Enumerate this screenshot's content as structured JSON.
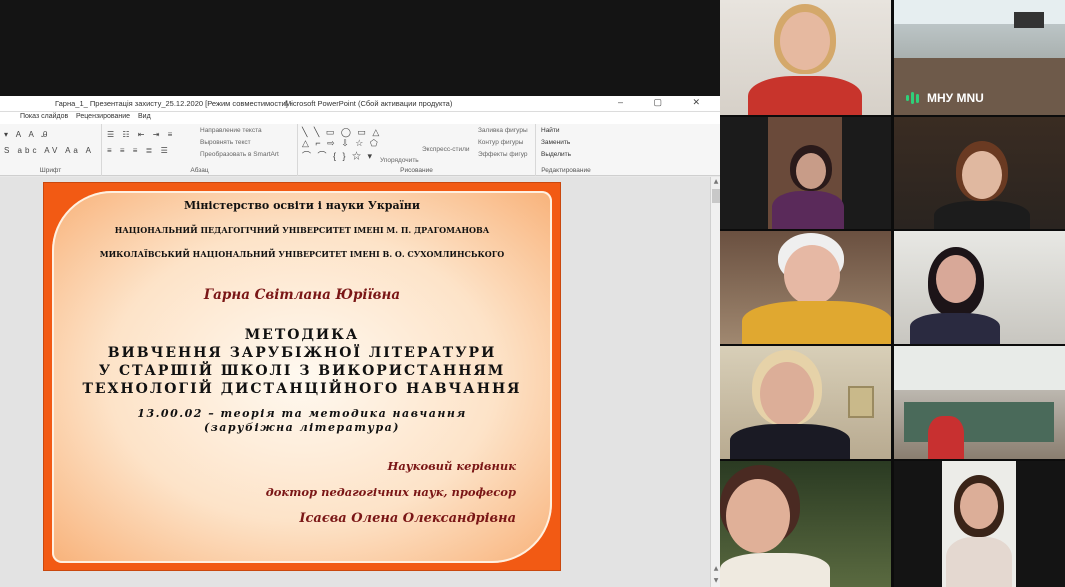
{
  "window": {
    "title": "Гарна_1_ Презентація захисту_25.12.2020 [Режим совместимости]  -",
    "app": "Microsoft PowerPoint (Сбой активации продукта)",
    "controls": "– ▢ ✕"
  },
  "tabs": [
    "Показ слайдов",
    "Рецензирование",
    "Вид"
  ],
  "ribbon": {
    "groups": [
      {
        "label": "Шрифт"
      },
      {
        "label": "Абзац"
      },
      {
        "label": "Рисование"
      },
      {
        "label": "Редактирование"
      }
    ],
    "paragraph_items": [
      "Направление текста",
      "Выровнять текст",
      "Преобразовать в SmartArt"
    ],
    "drawing_items": [
      "Упорядочить",
      "Экспресс-стили",
      "Заливка фигуры",
      "Контур фигуры",
      "Эффекты фигур"
    ],
    "editing_items": [
      "Найти",
      "Заменить",
      "Выделить"
    ]
  },
  "slide": {
    "ministry": "Міністерство освіти і науки України",
    "univ1": "НАЦІОНАЛЬНИЙ ПЕДАГОГІЧНИЙ УНІВЕРСИТЕТ ІМЕНІ М. П. ДРАГОМАНОВА",
    "univ2": "МИКОЛАЇВСЬКИЙ НАЦІОНАЛЬНИЙ УНІВЕРСИТЕТ ІМЕНІ В. О. СУХОМЛИНСЬКОГО",
    "author": "Гарна  Світлана  Юріївна",
    "title_l1": "МЕТОДИКА",
    "title_l2": "ВИВЧЕННЯ ЗАРУБІЖНОЇ ЛІТЕРАТУРИ",
    "title_l3": "У СТАРШІЙ ШКОЛІ З ВИКОРИСТАННЯМ",
    "title_l4": "ТЕХНОЛОГІЙ ДИСТАНЦІЙНОГО НАВЧАННЯ",
    "specialty_l1": "13.00.02 – теорія та методика навчання",
    "specialty_l2": "(зарубіжна література)",
    "supervisor_label": "Науковий  керівник",
    "supervisor_degree": "доктор  педагогічних  наук,  професор",
    "supervisor_name": "Ісаєва Олена Олександрівна"
  },
  "participants": {
    "speaker_label": "МНУ MNU"
  },
  "colors": {
    "slide_border": "#f25a14",
    "maroon": "#7a1616",
    "mic_active": "#2fd07a"
  }
}
